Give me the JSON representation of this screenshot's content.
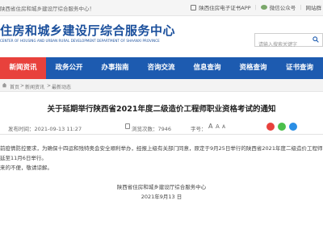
{
  "topbar": {
    "welcome": "陕西省住房和城乡建设厅综合服务中心！",
    "links": [
      "陕西住房电子证书APP",
      "微信公众号",
      "网站群"
    ]
  },
  "header": {
    "brand_cn": "住房和城乡建设厅综合服务中心",
    "brand_en": "CENTER OF HOUSING AND URBAN RURAL DEVELOPMENT DEPARTMENT OF SHAANXI PROVINCE",
    "search_placeholder": "请输入搜索关键字"
  },
  "nav": {
    "items": [
      "新闻资讯",
      "政务公开",
      "办事指南",
      "咨询交流",
      "信息查询",
      "资格查询",
      "证书查询"
    ],
    "active_index": 0,
    "colors": {
      "bar": "#1d5bb0",
      "active": "#e8413c"
    }
  },
  "breadcrumb": [
    "首页",
    "新闻资讯",
    "最新动态"
  ],
  "article": {
    "title": "关于延期举行陕西省2021年度二级造价工程师职业资格考试的通知",
    "meta": {
      "time": "发布时间：2021-09-13 11:27",
      "views": "浏览次数：7946",
      "font_size": "字号：",
      "font_sizes": [
        "A",
        "A",
        "A"
      ]
    },
    "paragraphs": [
      "前疫情防控要求，为确保十四运和残特奥会安全顺利举办，经报上级有关部门同意，原定于9月25日举行的陕西省2021年度二级造价工程师",
      "延至11月6日举行。",
      "来的不便，敬请谅解。"
    ],
    "signature": "陕西省住房和城乡建设厅综合服务中心",
    "date": "2021年9月13 日"
  }
}
